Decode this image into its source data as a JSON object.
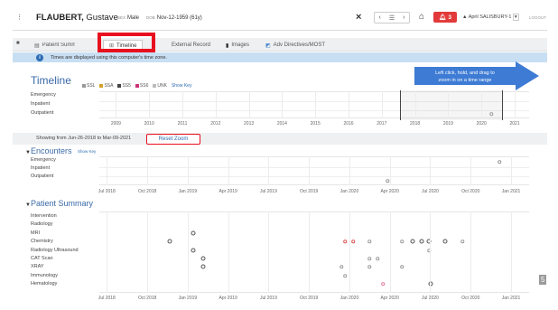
{
  "header": {
    "family_name": "FLAUBERT,",
    "given_name": "Gustave",
    "sex_label": "SEX",
    "sex": "Male",
    "dob_label": "DOB",
    "dob": "Nov-12-1959 (61y)",
    "close_icon": "×",
    "alert_count": "3",
    "user": "April SALISBURY-1",
    "logout": "LOGOUT"
  },
  "tabs": [
    {
      "label": "Patient Summary"
    },
    {
      "label": "Timeline"
    },
    {
      "label": "External Record"
    },
    {
      "label": "Images"
    },
    {
      "label": "Adv Directives/MOST"
    }
  ],
  "info_banner": "Times are displayed using this computer's time zone.",
  "callout": {
    "line1": "Left click, hold, and drag to",
    "line2": "zoom in on a time range",
    "color": "#3d7bd4"
  },
  "timeline": {
    "title": "Timeline",
    "legend": [
      {
        "label": "SSL",
        "color": "#999999"
      },
      {
        "label": "SSA",
        "color": "#d4a028"
      },
      {
        "label": "SS5",
        "color": "#444444"
      },
      {
        "label": "SS6",
        "color": "#cc3377"
      },
      {
        "label": "UNK",
        "color": "#bbbbbb"
      }
    ],
    "show_key": "Show Key",
    "rows": [
      "Emergency",
      "Inpatient",
      "Outpatient"
    ],
    "years": [
      "2009",
      "2010",
      "2011",
      "2012",
      "2013",
      "2014",
      "2015",
      "2016",
      "2017",
      "2018",
      "2019",
      "2020",
      "2021"
    ]
  },
  "zoom": {
    "text": "Showing from Jun-26-2018 to Mar-09-2021",
    "reset_label": "Reset Zoom"
  },
  "encounters": {
    "title": "Encounters",
    "show_key": "Show Key",
    "rows": [
      "Emergency",
      "Inpatient",
      "Outpatient"
    ]
  },
  "summary": {
    "title": "Patient Summary",
    "rows": [
      "Intervention",
      "Radiology",
      "MRI",
      "Chemistry",
      "Radiology Ultrasound",
      "CAT Scan",
      "XRAY",
      "Immunology",
      "Hematology"
    ]
  },
  "zoom_axis": [
    "Jul 2018",
    "Oct 2018",
    "Jan 2019",
    "Apr 2019",
    "Jul 2019",
    "Oct 2019",
    "Jan 2020",
    "Apr 2020",
    "Jul 2020",
    "Oct 2020",
    "Jan 2021"
  ],
  "page_number": "5",
  "accent": "#3b6aa8",
  "highlight": "#e8101e"
}
